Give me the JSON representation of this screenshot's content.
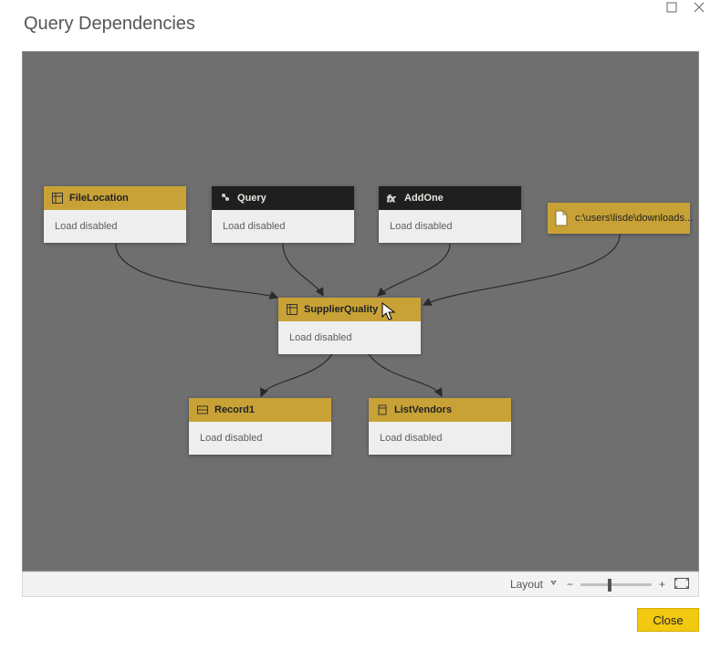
{
  "window": {
    "title": "Query Dependencies"
  },
  "nodes": {
    "fileLocation": {
      "label": "FileLocation",
      "status": "Load disabled"
    },
    "query": {
      "label": "Query",
      "status": "Load disabled"
    },
    "addOne": {
      "label": "AddOne",
      "status": "Load disabled"
    },
    "supplierQuality": {
      "label": "SupplierQuality",
      "status": "Load disabled"
    },
    "record1": {
      "label": "Record1",
      "status": "Load disabled"
    },
    "listVendors": {
      "label": "ListVendors",
      "status": "Load disabled"
    },
    "file": {
      "label": "c:\\users\\lisde\\downloads..."
    }
  },
  "toolbar": {
    "layoutLabel": "Layout"
  },
  "buttons": {
    "close": "Close"
  }
}
